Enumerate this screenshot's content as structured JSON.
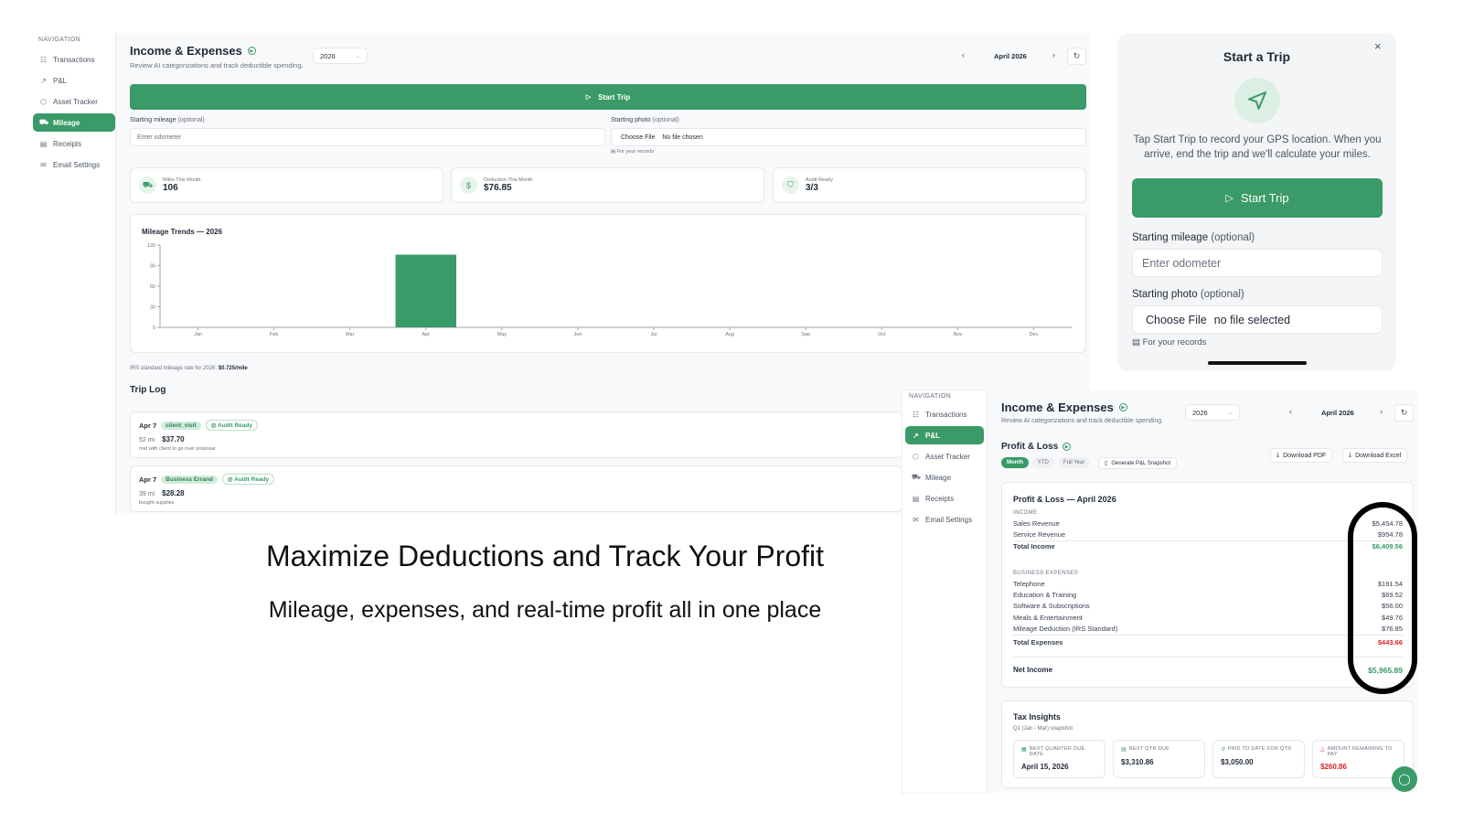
{
  "colors": {
    "accent": "#3a9a68",
    "negative": "#dc2626",
    "ring": "#000000"
  },
  "left_nav": {
    "title": "NAVIGATION",
    "items": [
      {
        "label": "Transactions",
        "icon": "list-icon"
      },
      {
        "label": "P&L",
        "icon": "trend-icon"
      },
      {
        "label": "Asset Tracker",
        "icon": "box-icon"
      },
      {
        "label": "Mileage",
        "icon": "car-icon",
        "active": true
      },
      {
        "label": "Receipts",
        "icon": "receipt-icon"
      },
      {
        "label": "Email Settings",
        "icon": "mail-icon"
      }
    ]
  },
  "main": {
    "title": "Income & Expenses",
    "subtitle": "Review AI categorizations and track deductible spending.",
    "year": "2026",
    "month": "April 2026",
    "start_trip_label": "Start Trip",
    "starting_mileage_label": "Starting mileage",
    "optional": "(optional)",
    "odometer_placeholder": "Enter odometer",
    "starting_photo_label": "Starting photo",
    "choose_file": "Choose File",
    "no_file": "No file chosen",
    "for_records": "For your records",
    "stats": [
      {
        "label": "Miles This Month",
        "value": "106",
        "icon": "car-icon"
      },
      {
        "label": "Deduction This Month",
        "value": "$76.85",
        "icon": "dollar-icon"
      },
      {
        "label": "Audit Ready",
        "value": "3/3",
        "icon": "shield-icon"
      }
    ],
    "irs_note": "IRS standard mileage rate for 2026:",
    "irs_rate": "$0.725/mile",
    "trip_log_title": "Trip Log",
    "trips": [
      {
        "date": "Apr 7",
        "tag": "client_visit",
        "audit": "Audit Ready",
        "miles": "52 mi",
        "amount": "$37.70",
        "note": "met with client to go over proposal"
      },
      {
        "date": "Apr 7",
        "tag": "Business Errand",
        "audit": "Audit Ready",
        "miles": "39 mi",
        "amount": "$28.28",
        "note": "bought supplies"
      }
    ]
  },
  "chart_data": {
    "type": "bar",
    "title": "Mileage Trends — 2026",
    "categories": [
      "Jan",
      "Feb",
      "Mar",
      "Apr",
      "May",
      "Jun",
      "Jul",
      "Aug",
      "Sep",
      "Oct",
      "Nov",
      "Dec"
    ],
    "values": [
      0,
      0,
      0,
      106,
      0,
      0,
      0,
      0,
      0,
      0,
      0,
      0
    ],
    "yticks": [
      0,
      30,
      60,
      90,
      120
    ],
    "ylim": [
      0,
      120
    ],
    "xlabel": "",
    "ylabel": ""
  },
  "trip_modal": {
    "title": "Start a Trip",
    "description": "Tap Start Trip to record your GPS location. When you arrive, end the trip and we'll calculate your miles.",
    "button": "Start Trip",
    "mileage_label": "Starting mileage",
    "optional": "(optional)",
    "placeholder": "Enter odometer",
    "photo_label": "Starting photo",
    "choose_file": "Choose File",
    "no_file": "no file selected",
    "records": "For your records"
  },
  "headline": "Maximize Deductions and Track Your Profit",
  "subheadline": "Mileage, expenses, and real-time profit all in one place",
  "pl_nav": {
    "title": "NAVIGATION",
    "items": [
      {
        "label": "Transactions",
        "icon": "list-icon"
      },
      {
        "label": "P&L",
        "icon": "trend-icon",
        "active": true
      },
      {
        "label": "Asset Tracker",
        "icon": "box-icon"
      },
      {
        "label": "Mileage",
        "icon": "car-icon"
      },
      {
        "label": "Receipts",
        "icon": "receipt-icon"
      },
      {
        "label": "Email Settings",
        "icon": "mail-icon"
      }
    ]
  },
  "pl": {
    "title": "Income & Expenses",
    "subtitle": "Review AI categorizations and track deductible spending.",
    "year": "2026",
    "month": "April 2026",
    "section_title": "Profit & Loss",
    "download_pdf": "Download PDF",
    "download_excel": "Download Excel",
    "tabs": [
      "Month",
      "YTD",
      "Full Year"
    ],
    "snapshot": "Generate P&L Snapshot",
    "report_title": "Profit & Loss — April 2026",
    "income_label": "INCOME",
    "income": [
      {
        "label": "Sales Revenue",
        "value": "$5,454.78"
      },
      {
        "label": "Service Revenue",
        "value": "$954.78"
      }
    ],
    "total_income_label": "Total Income",
    "total_income": "$6,409.56",
    "expenses_label": "BUSINESS EXPENSES",
    "expenses": [
      {
        "label": "Telephone",
        "value": "$191.54"
      },
      {
        "label": "Education & Training",
        "value": "$69.52"
      },
      {
        "label": "Software & Subscriptions",
        "value": "$56.00"
      },
      {
        "label": "Meals & Entertainment",
        "value": "$49.76"
      },
      {
        "label": "Mileage Deduction (IRS Standard)",
        "value": "$76.85"
      }
    ],
    "total_expenses_label": "Total Expenses",
    "total_expenses": "$443.66",
    "net_income_label": "Net Income",
    "net_income": "$5,965.89",
    "tax_title": "Tax Insights",
    "tax_sub": "Q1 (Jan - Mar) snapshot",
    "tax": [
      {
        "label": "NEXT QUARTER DUE DATE",
        "value": "April 15, 2026",
        "icon": "calendar-icon"
      },
      {
        "label": "NEXT QTR DUE",
        "value": "$3,310.86",
        "icon": "doc-icon"
      },
      {
        "label": "PAID TO DATE FOR QTR",
        "value": "$3,050.00",
        "icon": "check-icon"
      },
      {
        "label": "AMOUNT REMAINING TO PAY",
        "value": "$260.86",
        "icon": "alert-icon",
        "negative": true
      }
    ]
  }
}
